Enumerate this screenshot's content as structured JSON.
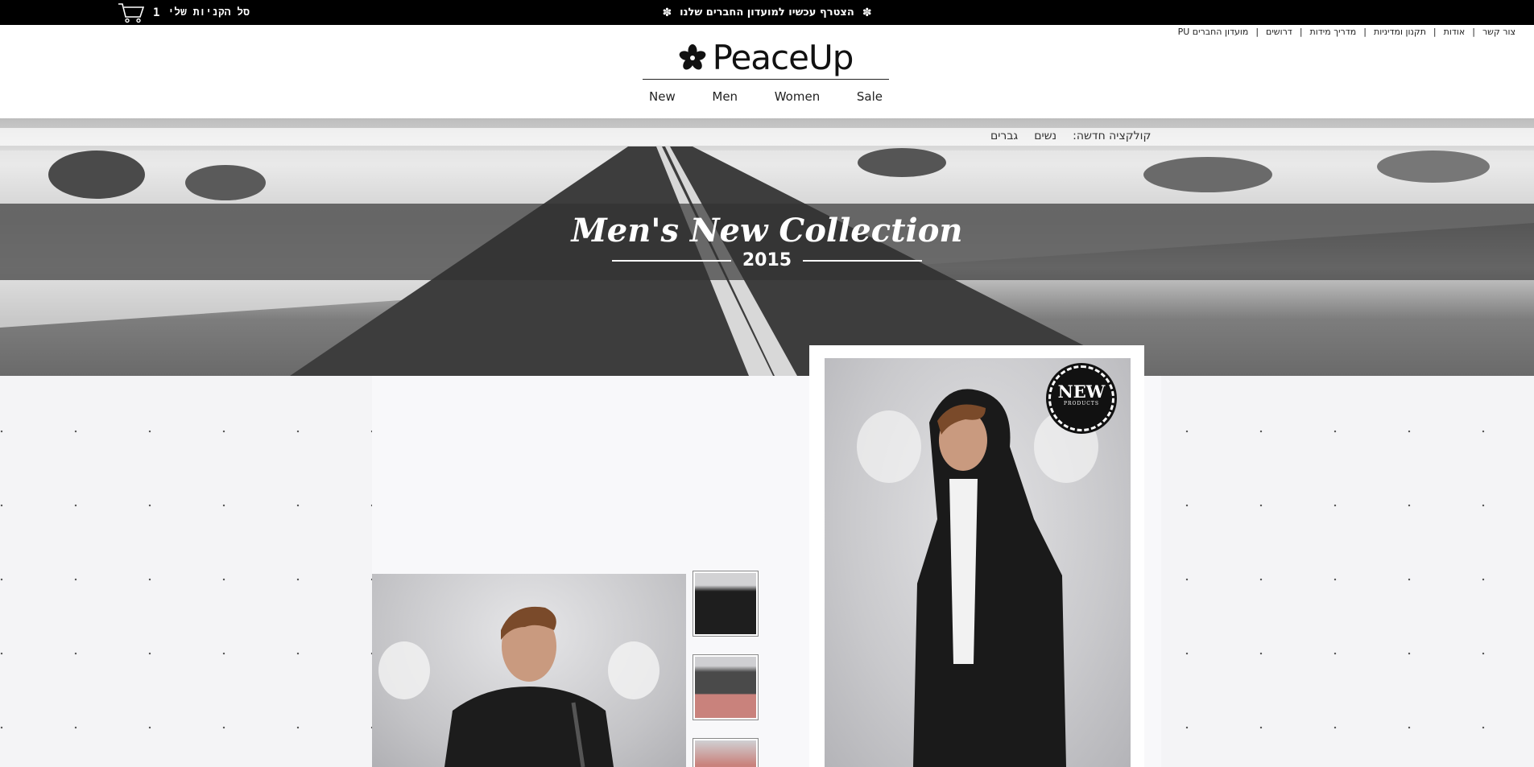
{
  "topbar": {
    "cart_count": "1",
    "cart_label": "סל הקניות שלי",
    "promo_text": "הצטרף עכשיו למועדון החברים שלנו",
    "promo_star": "✽"
  },
  "utility_nav": [
    {
      "label": "צור קשר"
    },
    {
      "label": "אודות"
    },
    {
      "label": "תקנון ומדיניות"
    },
    {
      "label": "מדריך מידות"
    },
    {
      "label": "דרושים"
    },
    {
      "label": "מועדון החברים PU"
    }
  ],
  "logo": {
    "text": "PeaceUp"
  },
  "main_nav": [
    {
      "label": "New"
    },
    {
      "label": "Men"
    },
    {
      "label": "Women"
    },
    {
      "label": "Sale"
    }
  ],
  "hero": {
    "subnav_title": "קולקציה חדשה:",
    "subnav_women": "נשים",
    "subnav_men": "גברים",
    "title": "Men's New Collection",
    "year": "2015"
  },
  "badge": {
    "big": "NEW",
    "small": "PRODUCTS"
  },
  "colors": {
    "topbar": "#000000",
    "hero_band": "#323232",
    "page_bg": "#f4f4f6"
  }
}
